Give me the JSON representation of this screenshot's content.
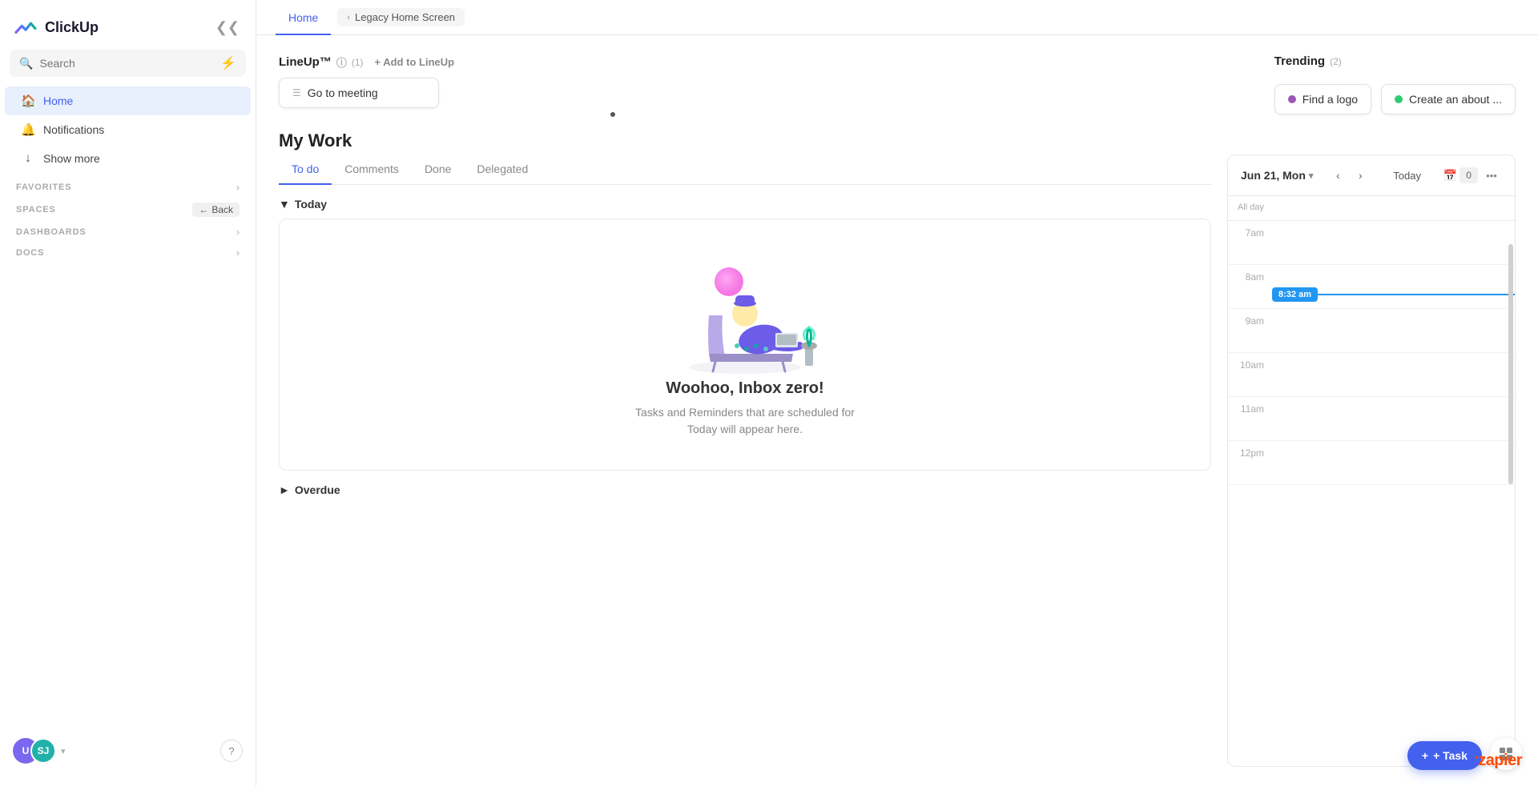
{
  "app": {
    "name": "ClickUp"
  },
  "sidebar": {
    "search_placeholder": "Search",
    "nav": [
      {
        "id": "home",
        "label": "Home",
        "icon": "🏠",
        "active": true
      },
      {
        "id": "notifications",
        "label": "Notifications",
        "icon": "🔔",
        "active": false
      },
      {
        "id": "show-more",
        "label": "Show more",
        "icon": "↓",
        "active": false
      }
    ],
    "sections": [
      {
        "id": "favorites",
        "label": "FAVORITES"
      },
      {
        "id": "spaces",
        "label": "SPACES"
      },
      {
        "id": "dashboards",
        "label": "DASHBOARDS"
      },
      {
        "id": "docs",
        "label": "DOCS"
      }
    ],
    "spaces_back_label": "Back",
    "user": {
      "avatar1_label": "U",
      "avatar2_label": "SJ"
    }
  },
  "tabs": {
    "home_label": "Home",
    "legacy_label": "Legacy Home Screen"
  },
  "lineup": {
    "title": "LineUp™",
    "info_icon": "ⓘ",
    "count": "(1)",
    "add_label": "+ Add to LineUp",
    "card": {
      "icon": "☰",
      "label": "Go to meeting"
    }
  },
  "trending": {
    "title": "Trending",
    "count": "(2)",
    "cards": [
      {
        "id": "find-logo",
        "dot_color": "#9b59b6",
        "label": "Find a logo"
      },
      {
        "id": "create-about",
        "dot_color": "#2ecc71",
        "label": "Create an about ..."
      }
    ]
  },
  "my_work": {
    "title": "My Work",
    "tabs": [
      {
        "id": "todo",
        "label": "To do",
        "active": true
      },
      {
        "id": "comments",
        "label": "Comments",
        "active": false
      },
      {
        "id": "done",
        "label": "Done",
        "active": false
      },
      {
        "id": "delegated",
        "label": "Delegated",
        "active": false
      }
    ]
  },
  "today_section": {
    "label": "Today",
    "inbox_zero_title": "Woohoo, Inbox zero!",
    "inbox_zero_subtitle": "Tasks and Reminders that are scheduled for\nToday will appear here."
  },
  "overdue_section": {
    "label": "Overdue"
  },
  "calendar": {
    "date_label": "Jun 21, Mon",
    "today_label": "Today",
    "badge_count": "0",
    "current_time": "8:32 am",
    "time_slots": [
      {
        "id": "7am",
        "label": "7am"
      },
      {
        "id": "8am",
        "label": "8am"
      },
      {
        "id": "9am",
        "label": "9am"
      },
      {
        "id": "10am",
        "label": "10am"
      },
      {
        "id": "11am",
        "label": "11am"
      },
      {
        "id": "12pm",
        "label": "12pm"
      }
    ]
  },
  "add_task_label": "+ Task",
  "zapier_label": "zapier"
}
